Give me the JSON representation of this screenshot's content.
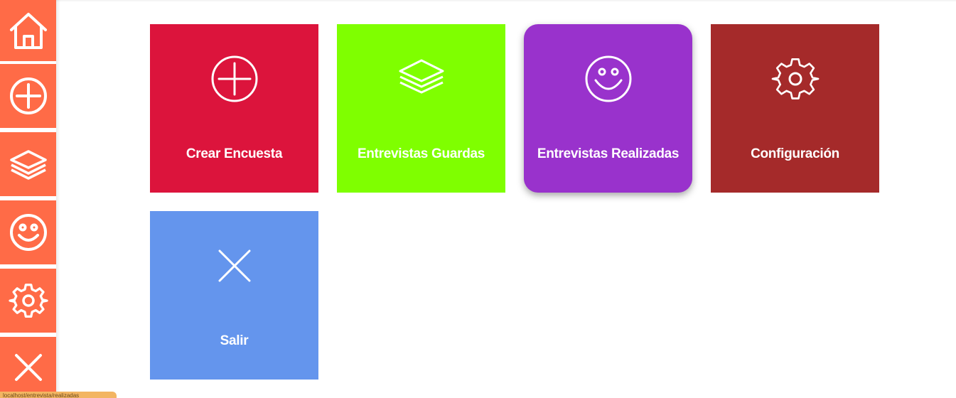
{
  "colors": {
    "sidebar": "#ff6b47",
    "crear": "#dc143c",
    "guardadas": "#7fff00",
    "realizadas": "#9932cc",
    "configuracion": "#a52a2a",
    "salir": "#6495ed"
  },
  "sidebar": {
    "items": [
      {
        "icon": "home-icon"
      },
      {
        "icon": "add-circle-icon"
      },
      {
        "icon": "layers-icon"
      },
      {
        "icon": "smiley-icon"
      },
      {
        "icon": "gear-icon"
      },
      {
        "icon": "close-icon"
      }
    ]
  },
  "tiles": [
    {
      "label": "Crear Encuesta",
      "icon": "add-circle-icon"
    },
    {
      "label": "Entrevistas Guardas",
      "icon": "layers-icon"
    },
    {
      "label": "Entrevistas Realizadas",
      "icon": "smiley-icon"
    },
    {
      "label": "Configuración",
      "icon": "gear-icon"
    },
    {
      "label": "Salir",
      "icon": "close-icon"
    }
  ],
  "status_tooltip": "localhost/entrevista/realizadas"
}
